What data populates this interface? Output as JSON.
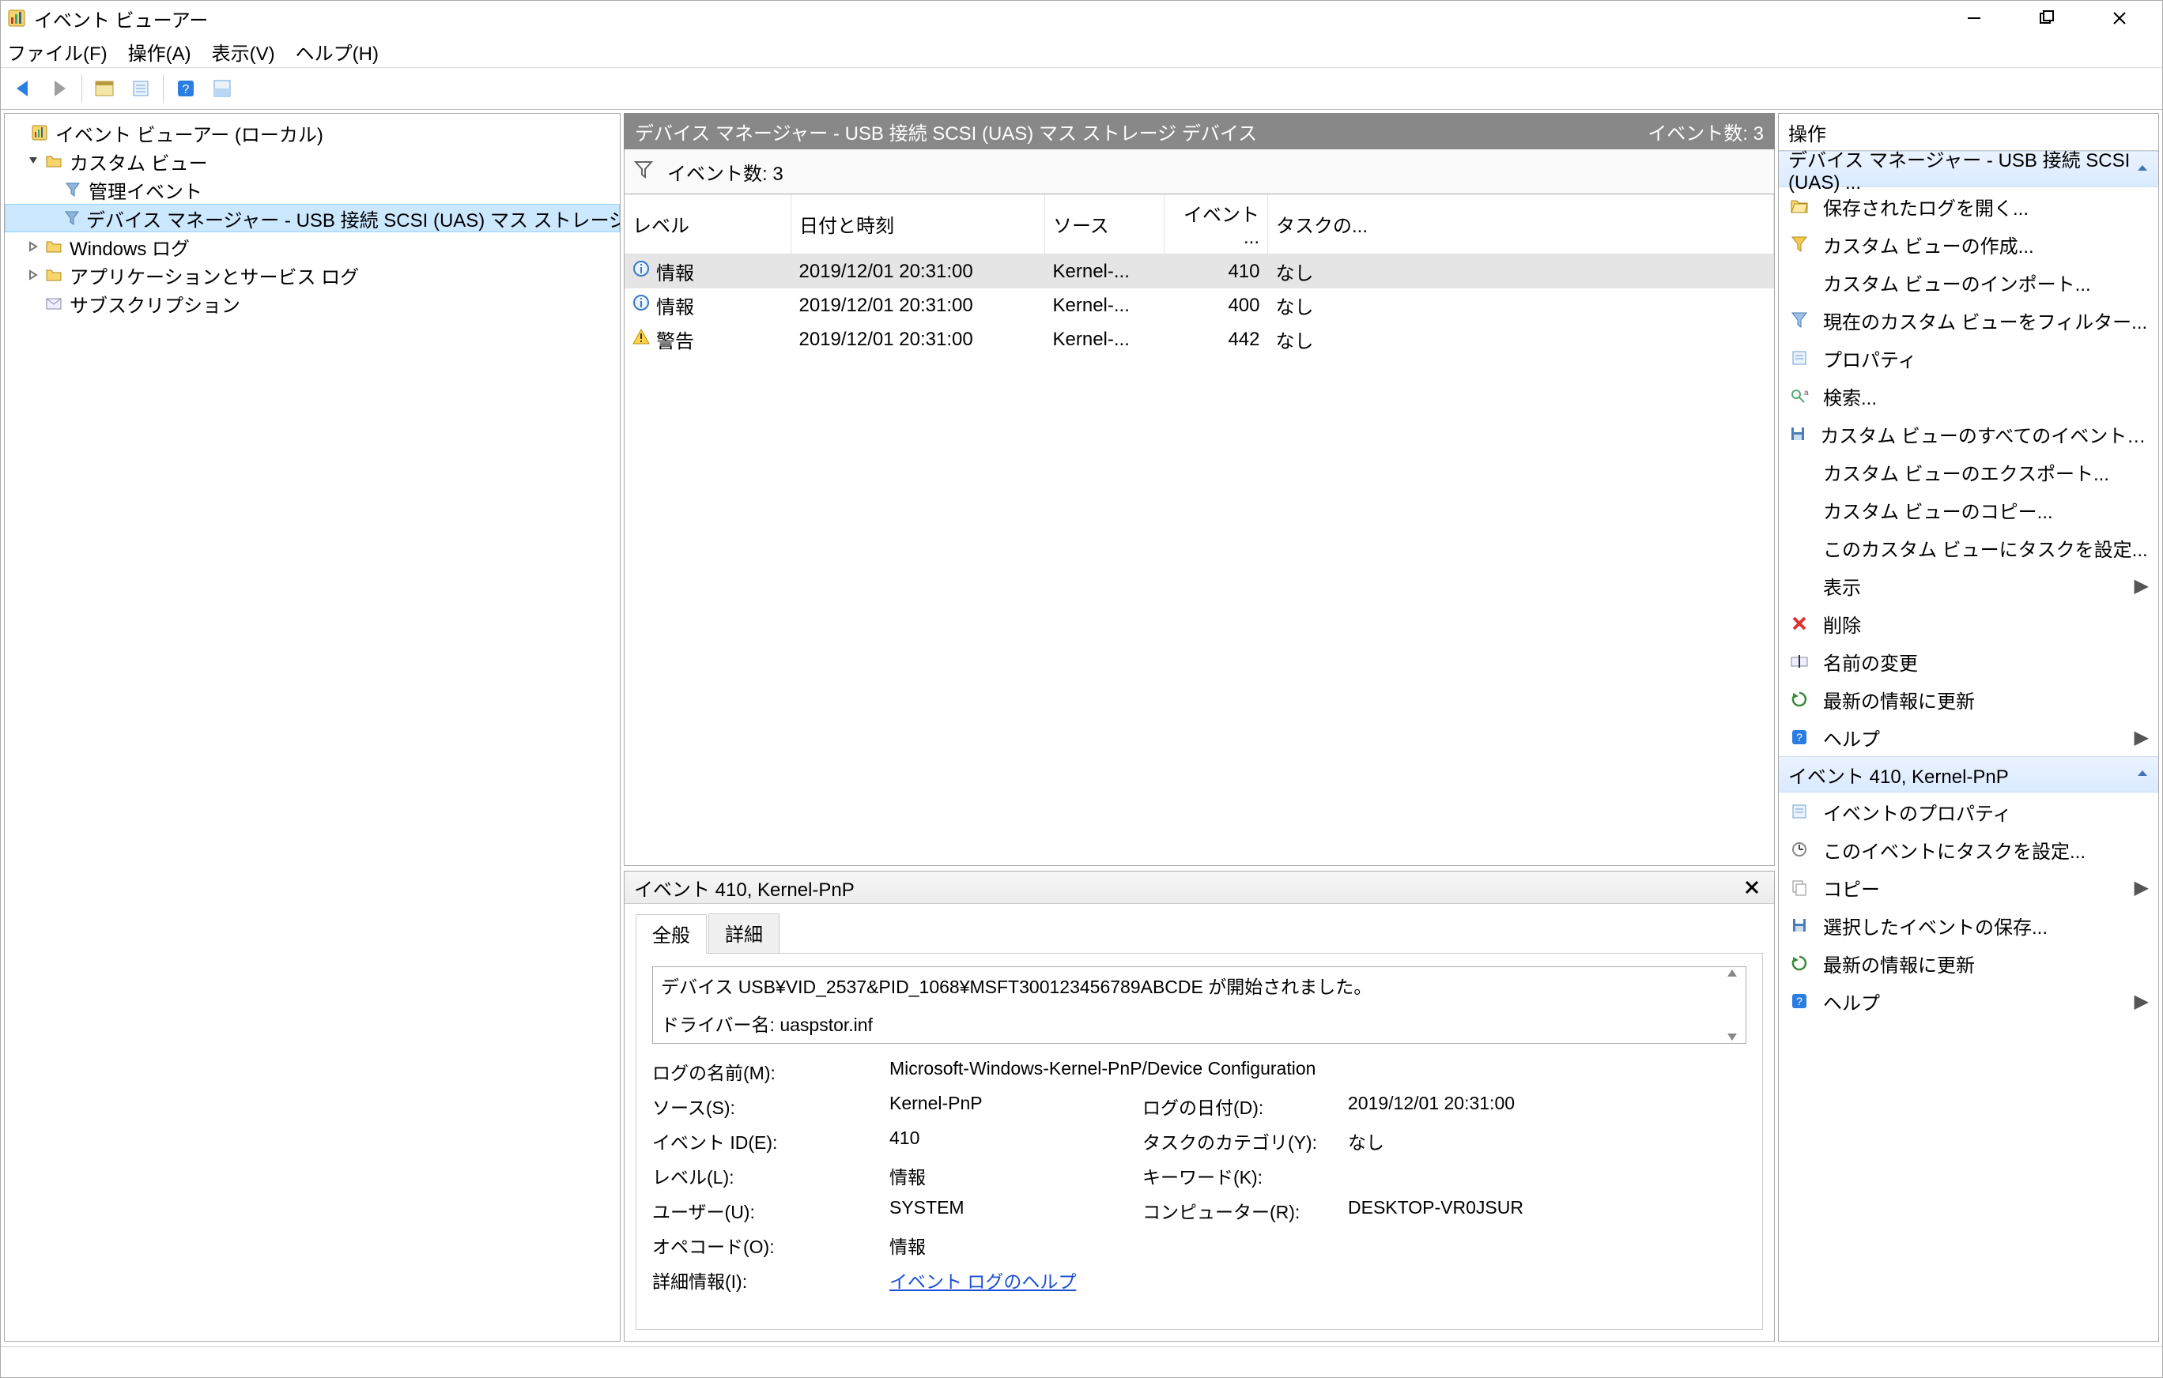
{
  "window": {
    "title": "イベント ビューアー"
  },
  "menu": {
    "file": "ファイル(F)",
    "action": "操作(A)",
    "view": "表示(V)",
    "help": "ヘルプ(H)"
  },
  "tree": {
    "root": "イベント ビューアー (ローカル)",
    "custom": "カスタム ビュー",
    "admin": "管理イベント",
    "selected": "デバイス マネージャー - USB 接続 SCSI (UAS) マス ストレージ デバイス",
    "winlogs": "Windows ログ",
    "appsvc": "アプリケーションとサービス ログ",
    "subs": "サブスクリプション"
  },
  "center": {
    "header_title": "デバイス マネージャー - USB 接続 SCSI (UAS) マス ストレージ デバイス",
    "header_count": "イベント数: 3",
    "filterbar": "イベント数: 3",
    "columns": {
      "level": "レベル",
      "datetime": "日付と時刻",
      "source": "ソース",
      "eventid": "イベント ...",
      "task": "タスクの..."
    },
    "rows": [
      {
        "icon": "info",
        "level": "情報",
        "datetime": "2019/12/01 20:31:00",
        "source": "Kernel-...",
        "eventid": "410",
        "task": "なし",
        "sel": true
      },
      {
        "icon": "info",
        "level": "情報",
        "datetime": "2019/12/01 20:31:00",
        "source": "Kernel-...",
        "eventid": "400",
        "task": "なし",
        "sel": false
      },
      {
        "icon": "warn",
        "level": "警告",
        "datetime": "2019/12/01 20:31:00",
        "source": "Kernel-...",
        "eventid": "442",
        "task": "なし",
        "sel": false
      }
    ]
  },
  "detail": {
    "header": "イベント 410, Kernel-PnP",
    "tab_general": "全般",
    "tab_detail": "詳細",
    "message_l1": "デバイス USB¥VID_2537&PID_1068¥MSFT300123456789ABCDE が開始されました。",
    "message_l2": "ドライバー名: uaspstor.inf",
    "p_logname_lbl": "ログの名前(M):",
    "p_logname_val": "Microsoft-Windows-Kernel-PnP/Device Configuration",
    "p_source_lbl": "ソース(S):",
    "p_source_val": "Kernel-PnP",
    "p_logged_lbl": "ログの日付(D):",
    "p_logged_val": "2019/12/01 20:31:00",
    "p_eventid_lbl": "イベント ID(E):",
    "p_eventid_val": "410",
    "p_taskcat_lbl": "タスクのカテゴリ(Y):",
    "p_taskcat_val": "なし",
    "p_level_lbl": "レベル(L):",
    "p_level_val": "情報",
    "p_keywords_lbl": "キーワード(K):",
    "p_keywords_val": "",
    "p_user_lbl": "ユーザー(U):",
    "p_user_val": "SYSTEM",
    "p_computer_lbl": "コンピューター(R):",
    "p_computer_val": "DESKTOP-VR0JSUR",
    "p_opcode_lbl": "オペコード(O):",
    "p_opcode_val": "情報",
    "p_more_lbl": "詳細情報(I):",
    "p_more_link": "イベント ログのヘルプ"
  },
  "actions": {
    "title": "操作",
    "section1": "デバイス マネージャー - USB 接続 SCSI (UAS) ...",
    "a1": "保存されたログを開く...",
    "a2": "カスタム ビューの作成...",
    "a3": "カスタム ビューのインポート...",
    "a4": "現在のカスタム ビューをフィルター...",
    "a5": "プロパティ",
    "a6": "検索...",
    "a7": "カスタム ビューのすべてのイベントを名前...",
    "a8": "カスタム ビューのエクスポート...",
    "a9": "カスタム ビューのコピー...",
    "a10": "このカスタム ビューにタスクを設定...",
    "a11": "表示",
    "a12": "削除",
    "a13": "名前の変更",
    "a14": "最新の情報に更新",
    "a15": "ヘルプ",
    "section2": "イベント 410, Kernel-PnP",
    "b1": "イベントのプロパティ",
    "b2": "このイベントにタスクを設定...",
    "b3": "コピー",
    "b4": "選択したイベントの保存...",
    "b5": "最新の情報に更新",
    "b6": "ヘルプ"
  }
}
